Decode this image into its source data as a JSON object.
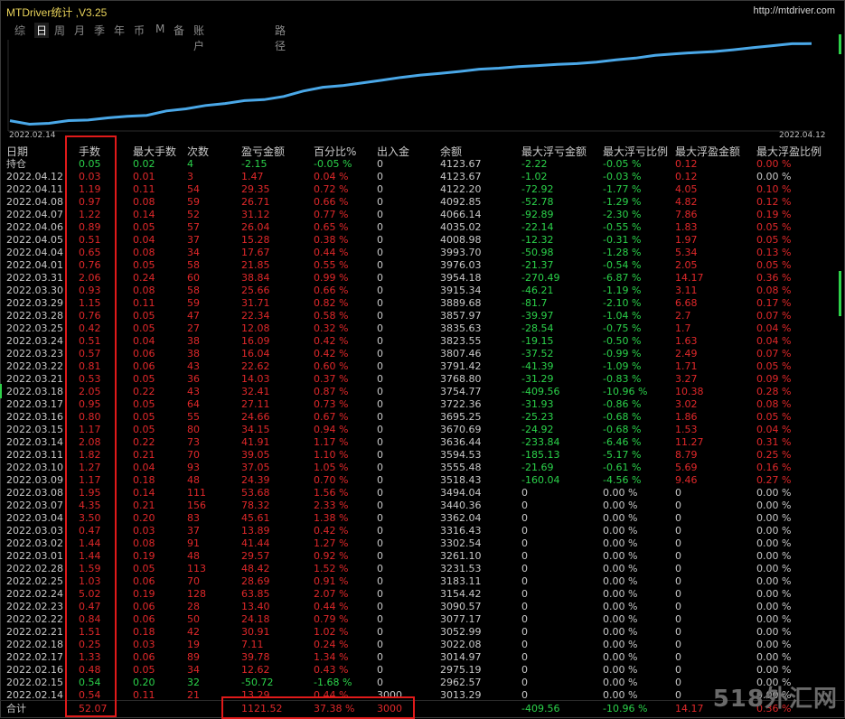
{
  "window": {
    "title": "MTDriver统计 ,V3.25",
    "site": "http://mtdriver.com"
  },
  "tabs": [
    {
      "label": "综",
      "active": false
    },
    {
      "label": "日",
      "active": true
    },
    {
      "label": "周",
      "active": false
    },
    {
      "label": "月",
      "active": false
    },
    {
      "label": "季",
      "active": false
    },
    {
      "label": "年",
      "active": false
    },
    {
      "label": "币",
      "active": false
    },
    {
      "label": "M",
      "active": false
    },
    {
      "label": "备",
      "active": false
    },
    {
      "label": "账户",
      "active": false
    },
    {
      "label": "路径",
      "active": false
    }
  ],
  "chart_data": {
    "type": "line",
    "x_start_label": "2022.02.14",
    "x_end_label": "2022.04.12",
    "x": [
      "2022.02.14",
      "2022.02.15",
      "2022.02.16",
      "2022.02.17",
      "2022.02.18",
      "2022.02.21",
      "2022.02.22",
      "2022.02.23",
      "2022.02.24",
      "2022.02.25",
      "2022.02.28",
      "2022.03.01",
      "2022.03.02",
      "2022.03.03",
      "2022.03.04",
      "2022.03.07",
      "2022.03.08",
      "2022.03.09",
      "2022.03.10",
      "2022.03.11",
      "2022.03.14",
      "2022.03.15",
      "2022.03.16",
      "2022.03.17",
      "2022.03.18",
      "2022.03.21",
      "2022.03.22",
      "2022.03.23",
      "2022.03.24",
      "2022.03.25",
      "2022.03.28",
      "2022.03.29",
      "2022.03.30",
      "2022.03.31",
      "2022.04.01",
      "2022.04.04",
      "2022.04.05",
      "2022.04.06",
      "2022.04.07",
      "2022.04.08",
      "2022.04.11",
      "2022.04.12"
    ],
    "values": [
      3013.29,
      2962.57,
      2975.19,
      3014.97,
      3022.08,
      3052.99,
      3077.17,
      3090.57,
      3154.42,
      3183.11,
      3231.53,
      3261.1,
      3302.54,
      3316.43,
      3362.04,
      3440.36,
      3494.04,
      3518.43,
      3555.48,
      3594.53,
      3636.44,
      3670.69,
      3695.25,
      3722.36,
      3754.77,
      3768.8,
      3791.42,
      3807.46,
      3823.55,
      3835.63,
      3857.97,
      3889.68,
      3915.34,
      3954.18,
      3976.03,
      3993.7,
      4008.98,
      4035.02,
      4066.14,
      4092.85,
      4122.2,
      4123.67
    ],
    "ylim": [
      2930,
      4140
    ],
    "color": "#4aa8e8"
  },
  "table": {
    "headers": [
      "日期",
      "手数",
      "最大手数",
      "次数",
      "盈亏金额",
      "百分比%",
      "出入金",
      "余额",
      "最大浮亏金额",
      "最大浮亏比例",
      "最大浮盈金额",
      "最大浮盈比例"
    ],
    "position_row": [
      "持仓",
      "0.05",
      "0.02",
      "4",
      "-2.15",
      "-0.05 %",
      "0",
      "4123.67",
      "-2.22",
      "-0.05 %",
      "0.12",
      "0.00 %"
    ],
    "rows": [
      [
        "2022.04.12",
        "0.03",
        "0.01",
        "3",
        "1.47",
        "0.04 %",
        "0",
        "4123.67",
        "-1.02",
        "-0.03 %",
        "0.12",
        "0.00 %"
      ],
      [
        "2022.04.11",
        "1.19",
        "0.11",
        "54",
        "29.35",
        "0.72 %",
        "0",
        "4122.20",
        "-72.92",
        "-1.77 %",
        "4.05",
        "0.10 %"
      ],
      [
        "2022.04.08",
        "0.97",
        "0.08",
        "59",
        "26.71",
        "0.66 %",
        "0",
        "4092.85",
        "-52.78",
        "-1.29 %",
        "4.82",
        "0.12 %"
      ],
      [
        "2022.04.07",
        "1.22",
        "0.14",
        "52",
        "31.12",
        "0.77 %",
        "0",
        "4066.14",
        "-92.89",
        "-2.30 %",
        "7.86",
        "0.19 %"
      ],
      [
        "2022.04.06",
        "0.89",
        "0.05",
        "57",
        "26.04",
        "0.65 %",
        "0",
        "4035.02",
        "-22.14",
        "-0.55 %",
        "1.83",
        "0.05 %"
      ],
      [
        "2022.04.05",
        "0.51",
        "0.04",
        "37",
        "15.28",
        "0.38 %",
        "0",
        "4008.98",
        "-12.32",
        "-0.31 %",
        "1.97",
        "0.05 %"
      ],
      [
        "2022.04.04",
        "0.65",
        "0.08",
        "34",
        "17.67",
        "0.44 %",
        "0",
        "3993.70",
        "-50.98",
        "-1.28 %",
        "5.34",
        "0.13 %"
      ],
      [
        "2022.04.01",
        "0.76",
        "0.05",
        "58",
        "21.85",
        "0.55 %",
        "0",
        "3976.03",
        "-21.37",
        "-0.54 %",
        "2.05",
        "0.05 %"
      ],
      [
        "2022.03.31",
        "2.06",
        "0.24",
        "60",
        "38.84",
        "0.99 %",
        "0",
        "3954.18",
        "-270.49",
        "-6.87 %",
        "14.17",
        "0.36 %"
      ],
      [
        "2022.03.30",
        "0.93",
        "0.08",
        "58",
        "25.66",
        "0.66 %",
        "0",
        "3915.34",
        "-46.21",
        "-1.19 %",
        "3.11",
        "0.08 %"
      ],
      [
        "2022.03.29",
        "1.15",
        "0.11",
        "59",
        "31.71",
        "0.82 %",
        "0",
        "3889.68",
        "-81.7",
        "-2.10 %",
        "6.68",
        "0.17 %"
      ],
      [
        "2022.03.28",
        "0.76",
        "0.05",
        "47",
        "22.34",
        "0.58 %",
        "0",
        "3857.97",
        "-39.97",
        "-1.04 %",
        "2.7",
        "0.07 %"
      ],
      [
        "2022.03.25",
        "0.42",
        "0.05",
        "27",
        "12.08",
        "0.32 %",
        "0",
        "3835.63",
        "-28.54",
        "-0.75 %",
        "1.7",
        "0.04 %"
      ],
      [
        "2022.03.24",
        "0.51",
        "0.04",
        "38",
        "16.09",
        "0.42 %",
        "0",
        "3823.55",
        "-19.15",
        "-0.50 %",
        "1.63",
        "0.04 %"
      ],
      [
        "2022.03.23",
        "0.57",
        "0.06",
        "38",
        "16.04",
        "0.42 %",
        "0",
        "3807.46",
        "-37.52",
        "-0.99 %",
        "2.49",
        "0.07 %"
      ],
      [
        "2022.03.22",
        "0.81",
        "0.06",
        "43",
        "22.62",
        "0.60 %",
        "0",
        "3791.42",
        "-41.39",
        "-1.09 %",
        "1.71",
        "0.05 %"
      ],
      [
        "2022.03.21",
        "0.53",
        "0.05",
        "36",
        "14.03",
        "0.37 %",
        "0",
        "3768.80",
        "-31.29",
        "-0.83 %",
        "3.27",
        "0.09 %"
      ],
      [
        "2022.03.18",
        "2.05",
        "0.22",
        "43",
        "32.41",
        "0.87 %",
        "0",
        "3754.77",
        "-409.56",
        "-10.96 %",
        "10.38",
        "0.28 %"
      ],
      [
        "2022.03.17",
        "0.95",
        "0.05",
        "64",
        "27.11",
        "0.73 %",
        "0",
        "3722.36",
        "-31.93",
        "-0.86 %",
        "3.02",
        "0.08 %"
      ],
      [
        "2022.03.16",
        "0.80",
        "0.05",
        "55",
        "24.66",
        "0.67 %",
        "0",
        "3695.25",
        "-25.23",
        "-0.68 %",
        "1.86",
        "0.05 %"
      ],
      [
        "2022.03.15",
        "1.17",
        "0.05",
        "80",
        "34.15",
        "0.94 %",
        "0",
        "3670.69",
        "-24.92",
        "-0.68 %",
        "1.53",
        "0.04 %"
      ],
      [
        "2022.03.14",
        "2.08",
        "0.22",
        "73",
        "41.91",
        "1.17 %",
        "0",
        "3636.44",
        "-233.84",
        "-6.46 %",
        "11.27",
        "0.31 %"
      ],
      [
        "2022.03.11",
        "1.82",
        "0.21",
        "70",
        "39.05",
        "1.10 %",
        "0",
        "3594.53",
        "-185.13",
        "-5.17 %",
        "8.79",
        "0.25 %"
      ],
      [
        "2022.03.10",
        "1.27",
        "0.04",
        "93",
        "37.05",
        "1.05 %",
        "0",
        "3555.48",
        "-21.69",
        "-0.61 %",
        "5.69",
        "0.16 %"
      ],
      [
        "2022.03.09",
        "1.17",
        "0.18",
        "48",
        "24.39",
        "0.70 %",
        "0",
        "3518.43",
        "-160.04",
        "-4.56 %",
        "9.46",
        "0.27 %"
      ],
      [
        "2022.03.08",
        "1.95",
        "0.14",
        "111",
        "53.68",
        "1.56 %",
        "0",
        "3494.04",
        "0",
        "0.00 %",
        "0",
        "0.00 %"
      ],
      [
        "2022.03.07",
        "4.35",
        "0.21",
        "156",
        "78.32",
        "2.33 %",
        "0",
        "3440.36",
        "0",
        "0.00 %",
        "0",
        "0.00 %"
      ],
      [
        "2022.03.04",
        "3.50",
        "0.20",
        "83",
        "45.61",
        "1.38 %",
        "0",
        "3362.04",
        "0",
        "0.00 %",
        "0",
        "0.00 %"
      ],
      [
        "2022.03.03",
        "0.47",
        "0.03",
        "37",
        "13.89",
        "0.42 %",
        "0",
        "3316.43",
        "0",
        "0.00 %",
        "0",
        "0.00 %"
      ],
      [
        "2022.03.02",
        "1.44",
        "0.08",
        "91",
        "41.44",
        "1.27 %",
        "0",
        "3302.54",
        "0",
        "0.00 %",
        "0",
        "0.00 %"
      ],
      [
        "2022.03.01",
        "1.44",
        "0.19",
        "48",
        "29.57",
        "0.92 %",
        "0",
        "3261.10",
        "0",
        "0.00 %",
        "0",
        "0.00 %"
      ],
      [
        "2022.02.28",
        "1.59",
        "0.05",
        "113",
        "48.42",
        "1.52 %",
        "0",
        "3231.53",
        "0",
        "0.00 %",
        "0",
        "0.00 %"
      ],
      [
        "2022.02.25",
        "1.03",
        "0.06",
        "70",
        "28.69",
        "0.91 %",
        "0",
        "3183.11",
        "0",
        "0.00 %",
        "0",
        "0.00 %"
      ],
      [
        "2022.02.24",
        "5.02",
        "0.19",
        "128",
        "63.85",
        "2.07 %",
        "0",
        "3154.42",
        "0",
        "0.00 %",
        "0",
        "0.00 %"
      ],
      [
        "2022.02.23",
        "0.47",
        "0.06",
        "28",
        "13.40",
        "0.44 %",
        "0",
        "3090.57",
        "0",
        "0.00 %",
        "0",
        "0.00 %"
      ],
      [
        "2022.02.22",
        "0.84",
        "0.06",
        "50",
        "24.18",
        "0.79 %",
        "0",
        "3077.17",
        "0",
        "0.00 %",
        "0",
        "0.00 %"
      ],
      [
        "2022.02.21",
        "1.51",
        "0.18",
        "42",
        "30.91",
        "1.02 %",
        "0",
        "3052.99",
        "0",
        "0.00 %",
        "0",
        "0.00 %"
      ],
      [
        "2022.02.18",
        "0.25",
        "0.03",
        "19",
        "7.11",
        "0.24 %",
        "0",
        "3022.08",
        "0",
        "0.00 %",
        "0",
        "0.00 %"
      ],
      [
        "2022.02.17",
        "1.33",
        "0.06",
        "89",
        "39.78",
        "1.34 %",
        "0",
        "3014.97",
        "0",
        "0.00 %",
        "0",
        "0.00 %"
      ],
      [
        "2022.02.16",
        "0.48",
        "0.05",
        "34",
        "12.62",
        "0.43 %",
        "0",
        "2975.19",
        "0",
        "0.00 %",
        "0",
        "0.00 %"
      ],
      [
        "2022.02.15",
        "0.54",
        "0.20",
        "32",
        "-50.72",
        "-1.68 %",
        "0",
        "2962.57",
        "0",
        "0.00 %",
        "0",
        "0.00 %"
      ],
      [
        "2022.02.14",
        "0.54",
        "0.11",
        "21",
        "13.29",
        "0.44 %",
        "3000",
        "3013.29",
        "0",
        "0.00 %",
        "0",
        "0.00 %"
      ]
    ],
    "total_row": [
      "合计",
      "52.07",
      "",
      "",
      "1121.52",
      "37.38 %",
      "3000",
      "",
      "-409.56",
      "-10.96 %",
      "14.17",
      "0.36 %"
    ]
  },
  "watermark": "518外汇网",
  "colors": {
    "positive": "#e0282a",
    "negative": "#2bd24a",
    "neutral": "#c8c8c8",
    "title": "#e8d25a",
    "curve": "#4aa8e8",
    "highlight_box": "#e01a1a"
  }
}
